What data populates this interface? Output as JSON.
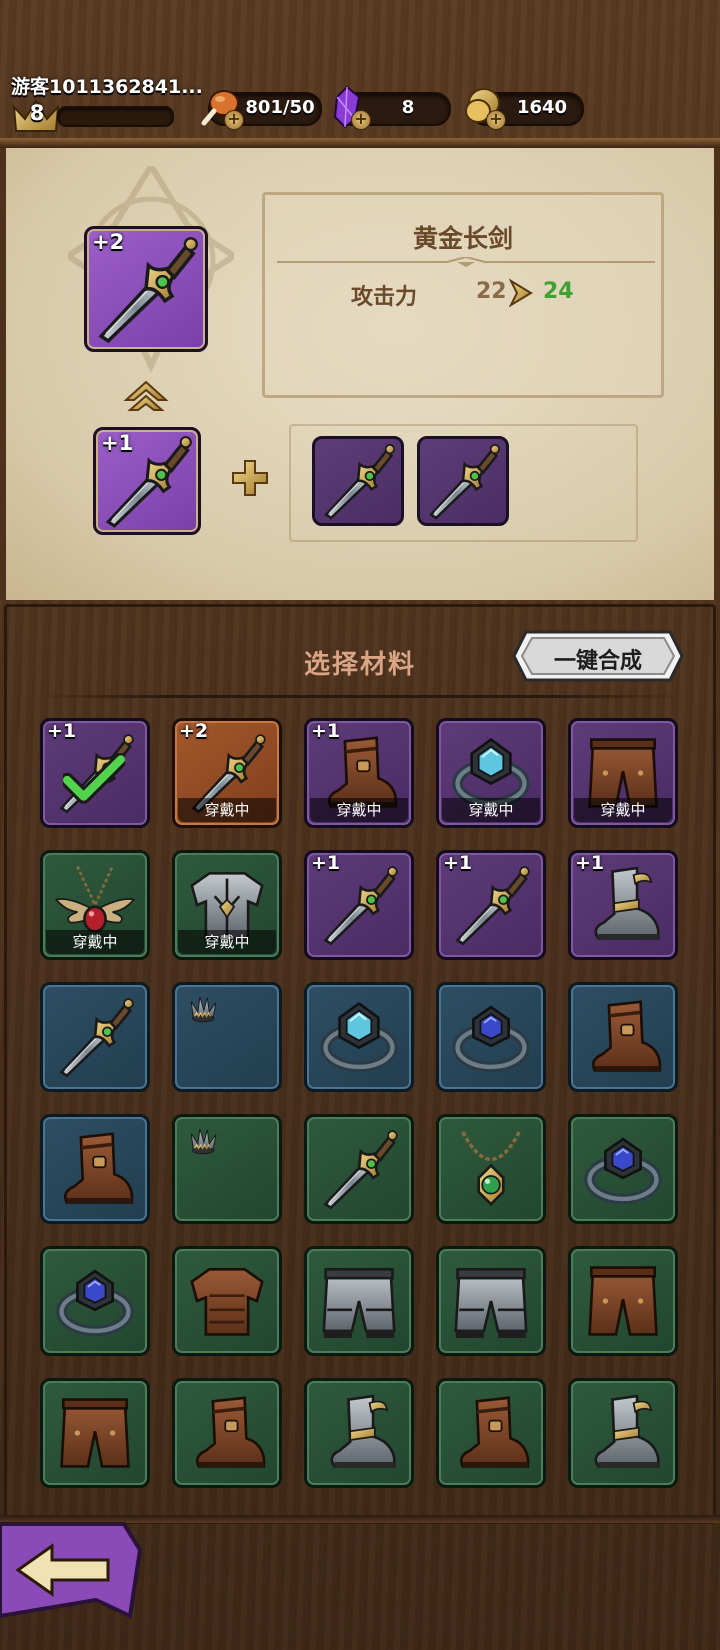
{
  "header": {
    "username": "游客1011362841...",
    "level": "8",
    "stamina": "801/50",
    "gems": "8",
    "gold": "1640"
  },
  "upgrade": {
    "target_level": "+2",
    "source_level": "+1",
    "item_name": "黄金长剑",
    "stat_label": "攻击力",
    "stat_old": "22",
    "stat_new": "24"
  },
  "materials": {
    "title": "选择材料",
    "auto_button": "一键合成",
    "equipped_label": "穿戴中",
    "items": [
      {
        "icon": "sword-icon",
        "rarity": "purple",
        "level": "+1",
        "equipped": false,
        "selected": true
      },
      {
        "icon": "sword-icon",
        "rarity": "orange",
        "level": "+2",
        "equipped": true,
        "selected": false
      },
      {
        "icon": "boot-icon",
        "rarity": "purple",
        "level": "+1",
        "equipped": true,
        "selected": false
      },
      {
        "icon": "ring-icon",
        "rarity": "purple",
        "level": "",
        "equipped": true,
        "selected": false
      },
      {
        "icon": "pants-icon",
        "rarity": "purple",
        "level": "",
        "equipped": true,
        "selected": false
      },
      {
        "icon": "necklace-icon",
        "rarity": "green",
        "level": "",
        "equipped": true,
        "selected": false
      },
      {
        "icon": "armor-icon",
        "rarity": "green",
        "level": "",
        "equipped": true,
        "selected": false
      },
      {
        "icon": "sword-icon",
        "rarity": "purple",
        "level": "+1",
        "equipped": false,
        "selected": false
      },
      {
        "icon": "sword-icon",
        "rarity": "purple",
        "level": "+1",
        "equipped": false,
        "selected": false
      },
      {
        "icon": "armored-boot-icon",
        "rarity": "purple",
        "level": "+1",
        "equipped": false,
        "selected": false
      },
      {
        "icon": "sword-icon",
        "rarity": "blue",
        "level": "",
        "equipped": false,
        "selected": false
      },
      {
        "icon": "crown-icon",
        "rarity": "blue",
        "level": "",
        "equipped": false,
        "selected": false
      },
      {
        "icon": "ring-icon",
        "rarity": "blue",
        "level": "",
        "equipped": false,
        "selected": false
      },
      {
        "icon": "ring-icon",
        "rarity": "blue",
        "level": "",
        "equipped": false,
        "selected": false
      },
      {
        "icon": "boot-icon",
        "rarity": "blue",
        "level": "",
        "equipped": false,
        "selected": false
      },
      {
        "icon": "boot-icon",
        "rarity": "blue",
        "level": "",
        "equipped": false,
        "selected": false
      },
      {
        "icon": "crown-icon",
        "rarity": "green",
        "level": "",
        "equipped": false,
        "selected": false
      },
      {
        "icon": "sword-icon",
        "rarity": "green",
        "level": "",
        "equipped": false,
        "selected": false
      },
      {
        "icon": "necklace-icon",
        "rarity": "green",
        "level": "",
        "equipped": false,
        "selected": false
      },
      {
        "icon": "ring-icon",
        "rarity": "green",
        "level": "",
        "equipped": false,
        "selected": false
      },
      {
        "icon": "ring-icon",
        "rarity": "green",
        "level": "",
        "equipped": false,
        "selected": false
      },
      {
        "icon": "armor-icon",
        "rarity": "green",
        "level": "",
        "equipped": false,
        "selected": false
      },
      {
        "icon": "metal-pants-icon",
        "rarity": "green",
        "level": "",
        "equipped": false,
        "selected": false
      },
      {
        "icon": "metal-pants-icon",
        "rarity": "green",
        "level": "",
        "equipped": false,
        "selected": false
      },
      {
        "icon": "pants-icon",
        "rarity": "green",
        "level": "",
        "equipped": false,
        "selected": false
      },
      {
        "icon": "pants-icon",
        "rarity": "green",
        "level": "",
        "equipped": false,
        "selected": false
      },
      {
        "icon": "boot-icon",
        "rarity": "green",
        "level": "",
        "equipped": false,
        "selected": false
      },
      {
        "icon": "armored-boot-icon",
        "rarity": "green",
        "level": "",
        "equipped": false,
        "selected": false
      },
      {
        "icon": "boot-icon",
        "rarity": "green",
        "level": "",
        "equipped": false,
        "selected": false
      },
      {
        "icon": "armored-boot-icon",
        "rarity": "green",
        "level": "",
        "equipped": false,
        "selected": false
      }
    ]
  },
  "colors": {
    "stat_increase": "#3fa132",
    "panel_bg": "#e3d7bd",
    "wood": "#4a301c"
  },
  "nav": {
    "back_icon": "back-arrow-icon"
  }
}
